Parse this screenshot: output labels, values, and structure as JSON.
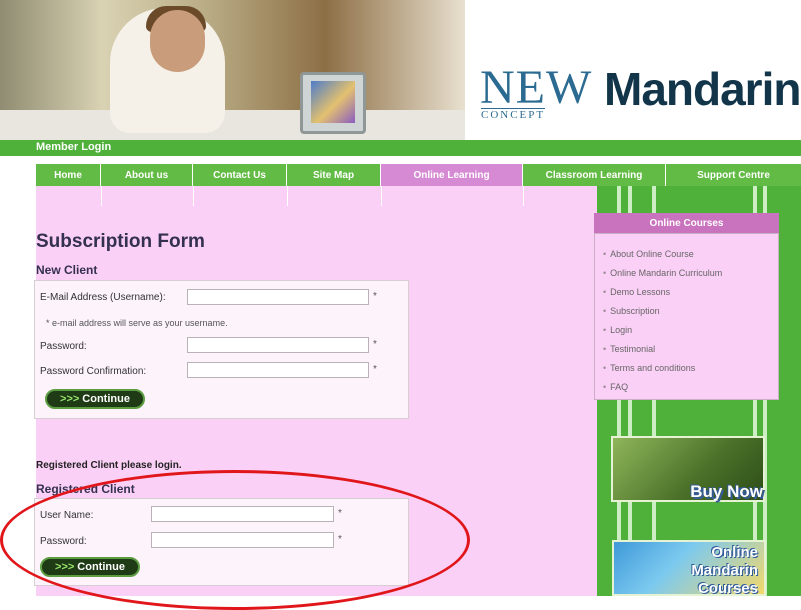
{
  "header": {
    "logo_new": "NEW",
    "logo_concept": "CONCEPT",
    "logo_mandarin": "Mandarin",
    "member_login": "Member Login"
  },
  "nav": {
    "items": [
      {
        "label": "Home"
      },
      {
        "label": "About us"
      },
      {
        "label": "Contact Us"
      },
      {
        "label": "Site Map"
      },
      {
        "label": "Online Learning",
        "active": true
      },
      {
        "label": "Classroom Learning"
      },
      {
        "label": "Support Centre"
      }
    ]
  },
  "form": {
    "title": "Subscription Form",
    "new_client": {
      "heading": "New Client",
      "email_label": "E-Mail Address (Username):",
      "email_value": "",
      "email_note": "* e-mail address will serve as your username.",
      "password_label": "Password:",
      "password_value": "",
      "confirm_label": "Password Confirmation:",
      "confirm_value": "",
      "required_mark": "*",
      "continue_label": "Continue",
      "continue_prefix": ">>>"
    },
    "registered": {
      "note": "Registered Client please login.",
      "heading": "Registered Client",
      "username_label": "User Name:",
      "username_value": "",
      "password_label": "Password:",
      "password_value": "",
      "required_mark": "*",
      "continue_label": "Continue",
      "continue_prefix": ">>>"
    }
  },
  "sidebar": {
    "heading": "Online Courses",
    "items": [
      "About Online Course",
      "Online Mandarin Curriculum",
      "Demo Lessons",
      "Subscription",
      "Login",
      "Testimonial",
      "Terms and conditions",
      "FAQ"
    ],
    "buy_now": "Buy Now",
    "promo_lines": [
      "Online",
      "Mandarin",
      "Courses"
    ]
  },
  "colors": {
    "nav_green": "#62bb44",
    "active_tab": "#d68ad3",
    "content_bg": "#fbd0f6",
    "annotation_red": "#e0161b"
  },
  "icons": {
    "bullet": "•"
  }
}
